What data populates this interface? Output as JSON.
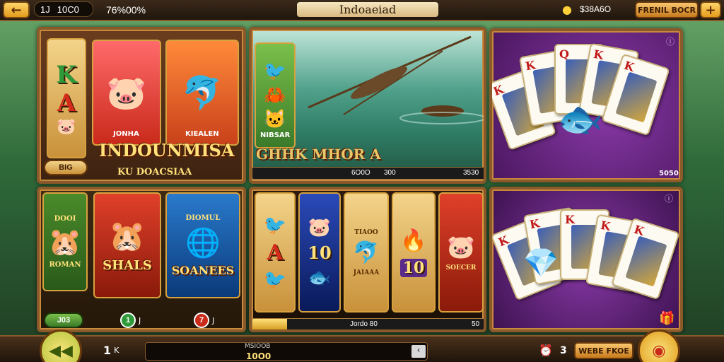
{
  "topbar": {
    "back_icon": "arrow-left-icon",
    "level": "1J",
    "credits": "10C0",
    "percent": "76%00%",
    "title": "Indoaeiad",
    "coin_icon": "coin-icon",
    "coin_balance": "$38A6O",
    "promo_label": "FRENIL BOCR",
    "plus_label": "+"
  },
  "panel_slots": {
    "side_letters": [
      "K",
      "A"
    ],
    "banner": "INDOUNMISA",
    "label_left": "JONHA",
    "label_right": "KIEALEN",
    "small_button": "BIG",
    "subtitle": "KU DOACSIAA"
  },
  "panel_lake": {
    "banner": "GHHK MHOR A",
    "small_label": "NIBSAR",
    "progress_left": "6O0O",
    "progress_mid": "300",
    "progress_right": "3530",
    "progress_fraction": 0.0
  },
  "panel_cards_top": {
    "corner_text": "5050",
    "cards": [
      "K",
      "K",
      "Q",
      "K",
      "K",
      "K"
    ]
  },
  "panel_fruit": {
    "tile1_top": "DOOI",
    "tile1_label": "ROMAN",
    "tile2_label": "SHALS",
    "tile3_top": "DIOMUL",
    "tile3_label": "SOANEES",
    "chip1": "J03",
    "chip2_num": "1",
    "chip2_suffix": "J",
    "chip3_num": "7",
    "chip3_suffix": "J"
  },
  "panel_reels": {
    "reel_letter": "A",
    "reel_number": "10",
    "reel_label_mid": "JAIAAA",
    "reel_label_right": "SOECER",
    "reel_bottom": "10",
    "reel_top_mid": "TIAOO",
    "progress_label": "Jordo 80",
    "progress_end": "50",
    "progress_fraction": 0.15
  },
  "panel_cards_bottom": {
    "cards": [
      "K",
      "K",
      "K",
      "K",
      "K"
    ]
  },
  "bottombar": {
    "left_icon": "rewind-icon",
    "level_num": "1",
    "level_suffix": "K",
    "bet_label": "MSIOOB",
    "bet_value": "10O0",
    "arrow_icon": "chevron-left-icon",
    "timer_icon": "alarm-icon",
    "spin_num": "3",
    "win_label": "WEBE FKOE",
    "spin_icon": "spin-icon"
  }
}
